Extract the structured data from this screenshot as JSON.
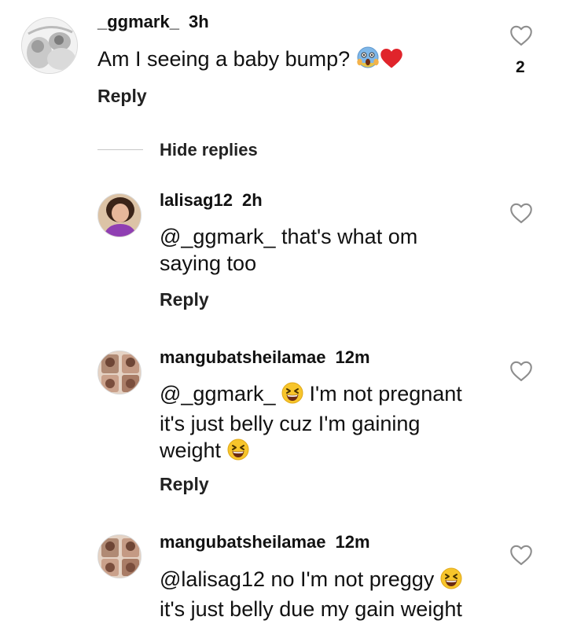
{
  "comments": [
    {
      "username": "_ggmark_",
      "time": "3h",
      "text": "Am I seeing a baby bump?",
      "emojis": [
        "face-screaming-emoji",
        "red-heart-emoji"
      ],
      "reply_label": "Reply",
      "like_count": "2"
    },
    {
      "username": "lalisag12",
      "time": "2h",
      "text_line1": "@_ggmark_ that's what om",
      "text_line2": "saying too",
      "reply_label": "Reply"
    },
    {
      "username": "mangubatsheilamae",
      "time": "12m",
      "text_line1a": "@_ggmark_",
      "text_line1b": "I'm not pregnant",
      "text_line2": "it's just belly cuz I'm gaining",
      "text_line3": "weight",
      "emojis": [
        "grinning-squinting-emoji",
        "grinning-squinting-emoji"
      ],
      "reply_label": "Reply"
    },
    {
      "username": "mangubatsheilamae",
      "time": "12m",
      "text_line1": "@lalisag12 no I'm not preggy",
      "text_line2": "it's just belly due my gain weight",
      "emojis": [
        "grinning-squinting-emoji"
      ]
    }
  ],
  "hide_replies_label": "Hide replies",
  "colors": {
    "text": "#111111",
    "divider": "#c7c7c7",
    "heart_outline": "#8e8e8e",
    "red_heart": "#e0242b",
    "emoji_yellow": "#f7c52b"
  }
}
